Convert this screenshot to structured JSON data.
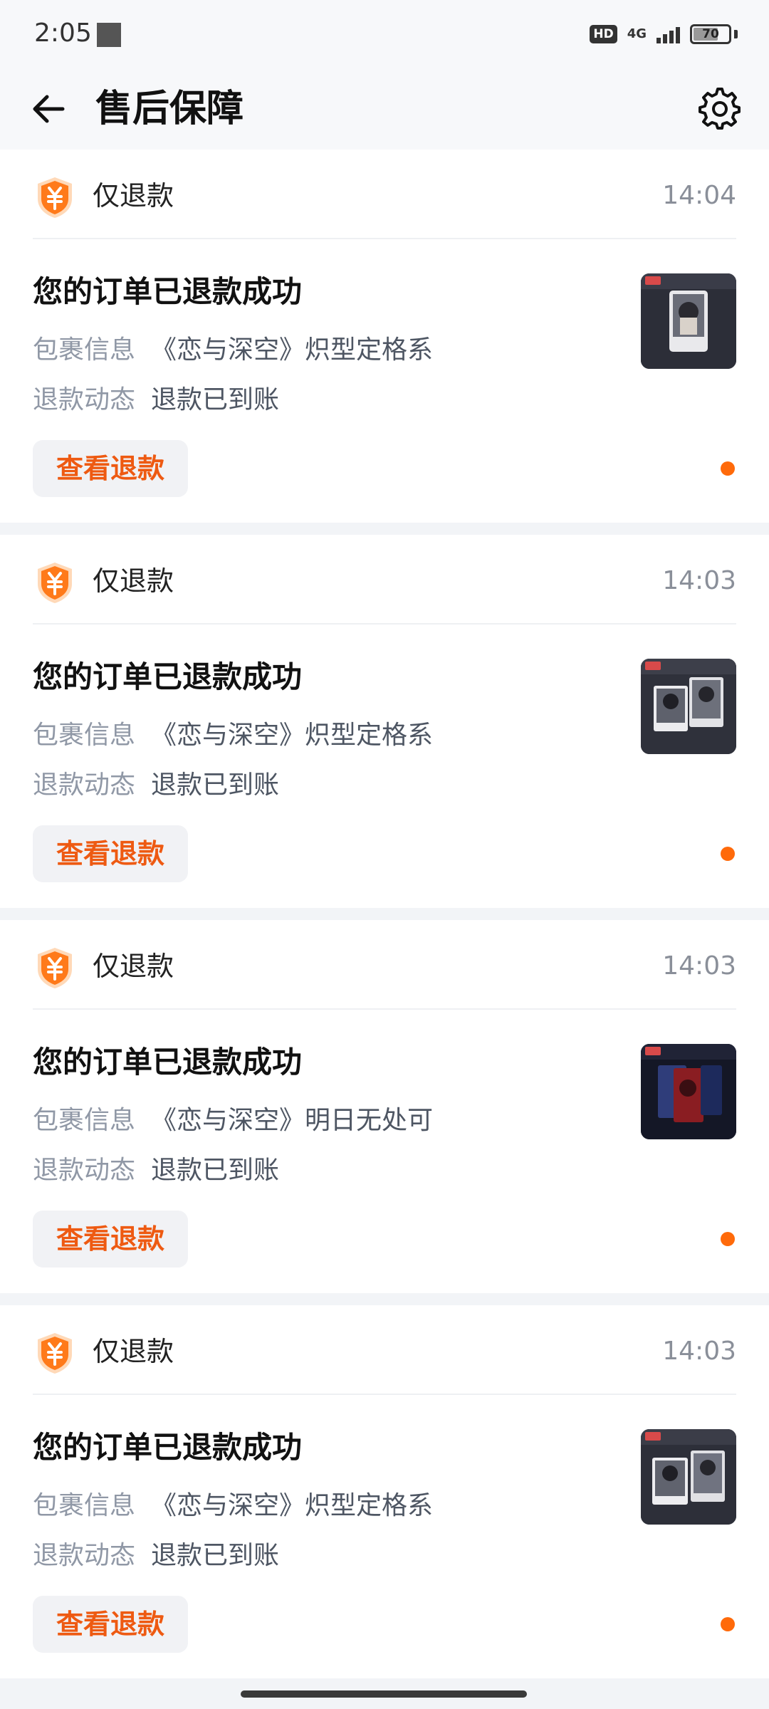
{
  "status_bar": {
    "time": "2:05",
    "hd": "HD",
    "network": "4G",
    "battery": "70"
  },
  "header": {
    "title": "售后保障",
    "back_icon": "arrow-left-icon",
    "settings_icon": "gear-icon"
  },
  "labels": {
    "package": "包裹信息",
    "refund_status": "退款动态"
  },
  "colors": {
    "accent": "#ee5a12",
    "dot": "#ff6a0a",
    "shield": "#ff7a1a"
  },
  "cards": [
    {
      "type": "仅退款",
      "time": "14:04",
      "title": "您的订单已退款成功",
      "package_info": "《恋与深空》炽型定格系",
      "refund_status": "退款已到账",
      "button": "查看退款"
    },
    {
      "type": "仅退款",
      "time": "14:03",
      "title": "您的订单已退款成功",
      "package_info": "《恋与深空》炽型定格系",
      "refund_status": "退款已到账",
      "button": "查看退款"
    },
    {
      "type": "仅退款",
      "time": "14:03",
      "title": "您的订单已退款成功",
      "package_info": "《恋与深空》明日无处可",
      "refund_status": "退款已到账",
      "button": "查看退款"
    },
    {
      "type": "仅退款",
      "time": "14:03",
      "title": "您的订单已退款成功",
      "package_info": "《恋与深空》炽型定格系",
      "refund_status": "退款已到账",
      "button": "查看退款"
    }
  ]
}
